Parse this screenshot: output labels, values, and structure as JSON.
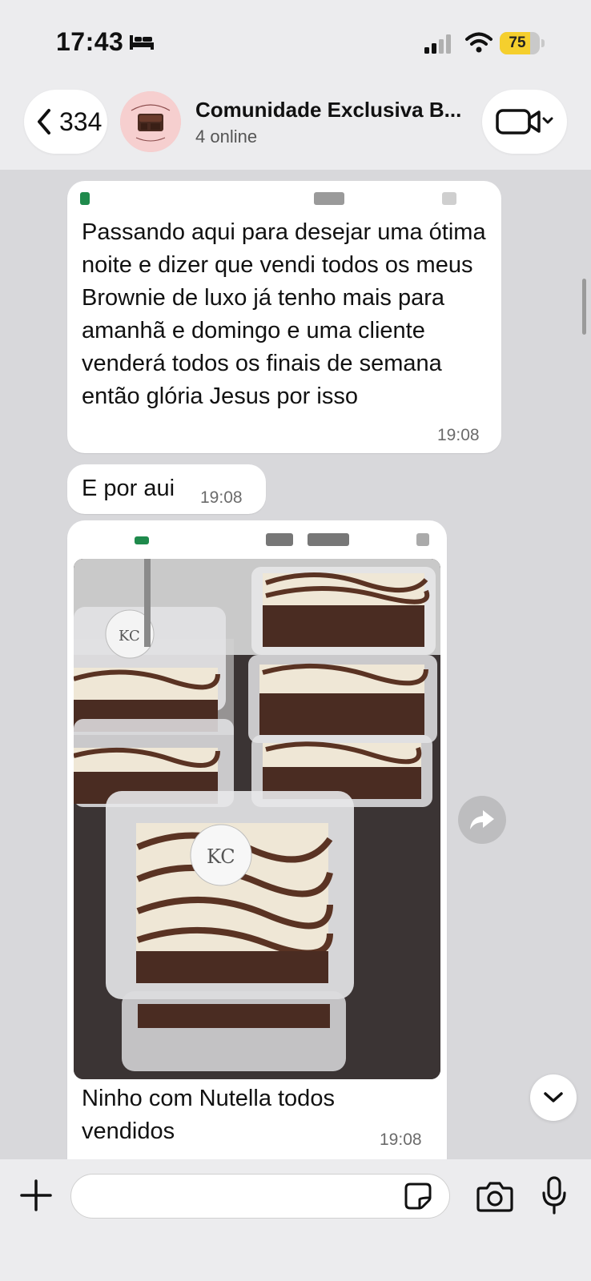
{
  "status_bar": {
    "time": "17:43",
    "battery_level": "75",
    "battery_fraction": 0.75
  },
  "header": {
    "back_count": "334",
    "chat_title": "Comunidade Exclusiva B...",
    "subtitle": "4 online"
  },
  "messages": [
    {
      "text": "Passando aqui para desejar uma ótima noite e dizer que vendi todos os meus Brownie de luxo já tenho mais para amanhã e domingo e uma cliente venderá todos os finais de semana então glória Jesus por isso",
      "time": "19:08"
    },
    {
      "text": "E por aui",
      "time": "19:08"
    },
    {
      "caption": "Ninho com Nutella todos vendidos",
      "time": "19:08"
    }
  ],
  "input": {
    "placeholder": ""
  },
  "colors": {
    "background": "#d8d8db",
    "bubble": "#ffffff",
    "battery": "#f5cf2d"
  },
  "icons": {
    "back": "chevron-left-icon",
    "video": "video-camera-icon",
    "forward": "forward-arrow-icon",
    "scroll_down": "chevron-down-icon",
    "plus": "plus-icon",
    "sticker": "sticker-icon",
    "camera": "camera-icon",
    "mic": "microphone-icon"
  }
}
